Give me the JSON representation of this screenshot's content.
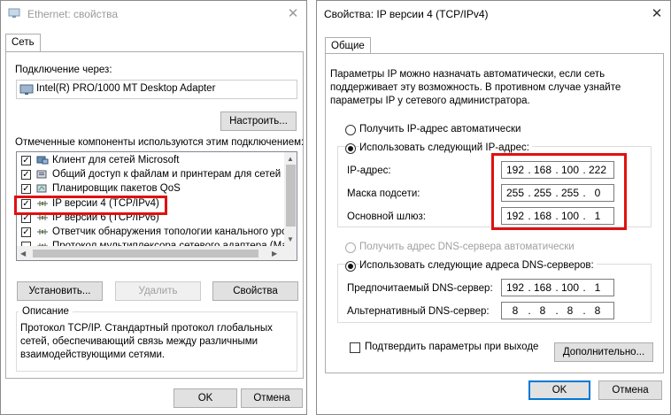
{
  "ethernet_window": {
    "title": "Ethernet: свойства",
    "tab": "Сеть",
    "connect_using_label": "Подключение через:",
    "adapter_name": "Intel(R) PRO/1000 MT Desktop Adapter",
    "configure_button": "Настроить...",
    "components_label": "Отмеченные компоненты используются этим подключением:",
    "components": [
      {
        "label": "Клиент для сетей Microsoft",
        "checked": true,
        "icon": "network-client-icon"
      },
      {
        "label": "Общий доступ к файлам и принтерам для сетей Mi",
        "checked": true,
        "icon": "file-sharing-icon"
      },
      {
        "label": "Планировщик пакетов QoS",
        "checked": true,
        "icon": "qos-icon"
      },
      {
        "label": "IP версии 4 (TCP/IPv4)",
        "checked": true,
        "icon": "protocol-icon"
      },
      {
        "label": "IP версии 6 (TCP/IPv6)",
        "checked": true,
        "icon": "protocol-icon"
      },
      {
        "label": "Ответчик обнаружения топологии канального уров",
        "checked": true,
        "icon": "protocol-icon"
      },
      {
        "label": "Протокол мультиплексора сетевого адаптера (Ма",
        "checked": false,
        "icon": "protocol-icon"
      }
    ],
    "install_button": "Установить...",
    "remove_button": "Удалить",
    "properties_button": "Свойства",
    "description_label": "Описание",
    "description_lines": [
      "Протокол TCP/IP. Стандартный протокол глобальных",
      "сетей, обеспечивающий связь между различными",
      "взаимодействующими сетями."
    ],
    "ok_button": "OK",
    "cancel_button": "Отмена"
  },
  "ipv4_window": {
    "title": "Свойства: IP версии 4 (TCP/IPv4)",
    "tab": "Общие",
    "intro_lines": [
      "Параметры IP можно назначать автоматически, если сеть",
      "поддерживает эту возможность. В противном случае узнайте",
      "параметры IP у сетевого администратора."
    ],
    "auto_ip_label": "Получить IP-адрес автоматически",
    "manual_ip_label": "Использовать следующий IP-адрес:",
    "ip_address_label": "IP-адрес:",
    "ip_address": [
      "192",
      "168",
      "100",
      "222"
    ],
    "subnet_mask_label": "Маска подсети:",
    "subnet_mask": [
      "255",
      "255",
      "255",
      "0"
    ],
    "gateway_label": "Основной шлюз:",
    "gateway": [
      "192",
      "168",
      "100",
      "1"
    ],
    "auto_dns_label": "Получить адрес DNS-сервера автоматически",
    "manual_dns_label": "Использовать следующие адреса DNS-серверов:",
    "preferred_dns_label": "Предпочитаемый DNS-сервер:",
    "preferred_dns": [
      "192",
      "168",
      "100",
      "1"
    ],
    "alternate_dns_label": "Альтернативный DNS-сервер:",
    "alternate_dns": [
      "8",
      "8",
      "8",
      "8"
    ],
    "validate_label": "Подтвердить параметры при выходе",
    "advanced_button": "Дополнительно...",
    "ok_button": "OK",
    "cancel_button": "Отмена"
  },
  "colors": {
    "highlight_red": "#e01010",
    "default_button_border": "#0078d7"
  }
}
